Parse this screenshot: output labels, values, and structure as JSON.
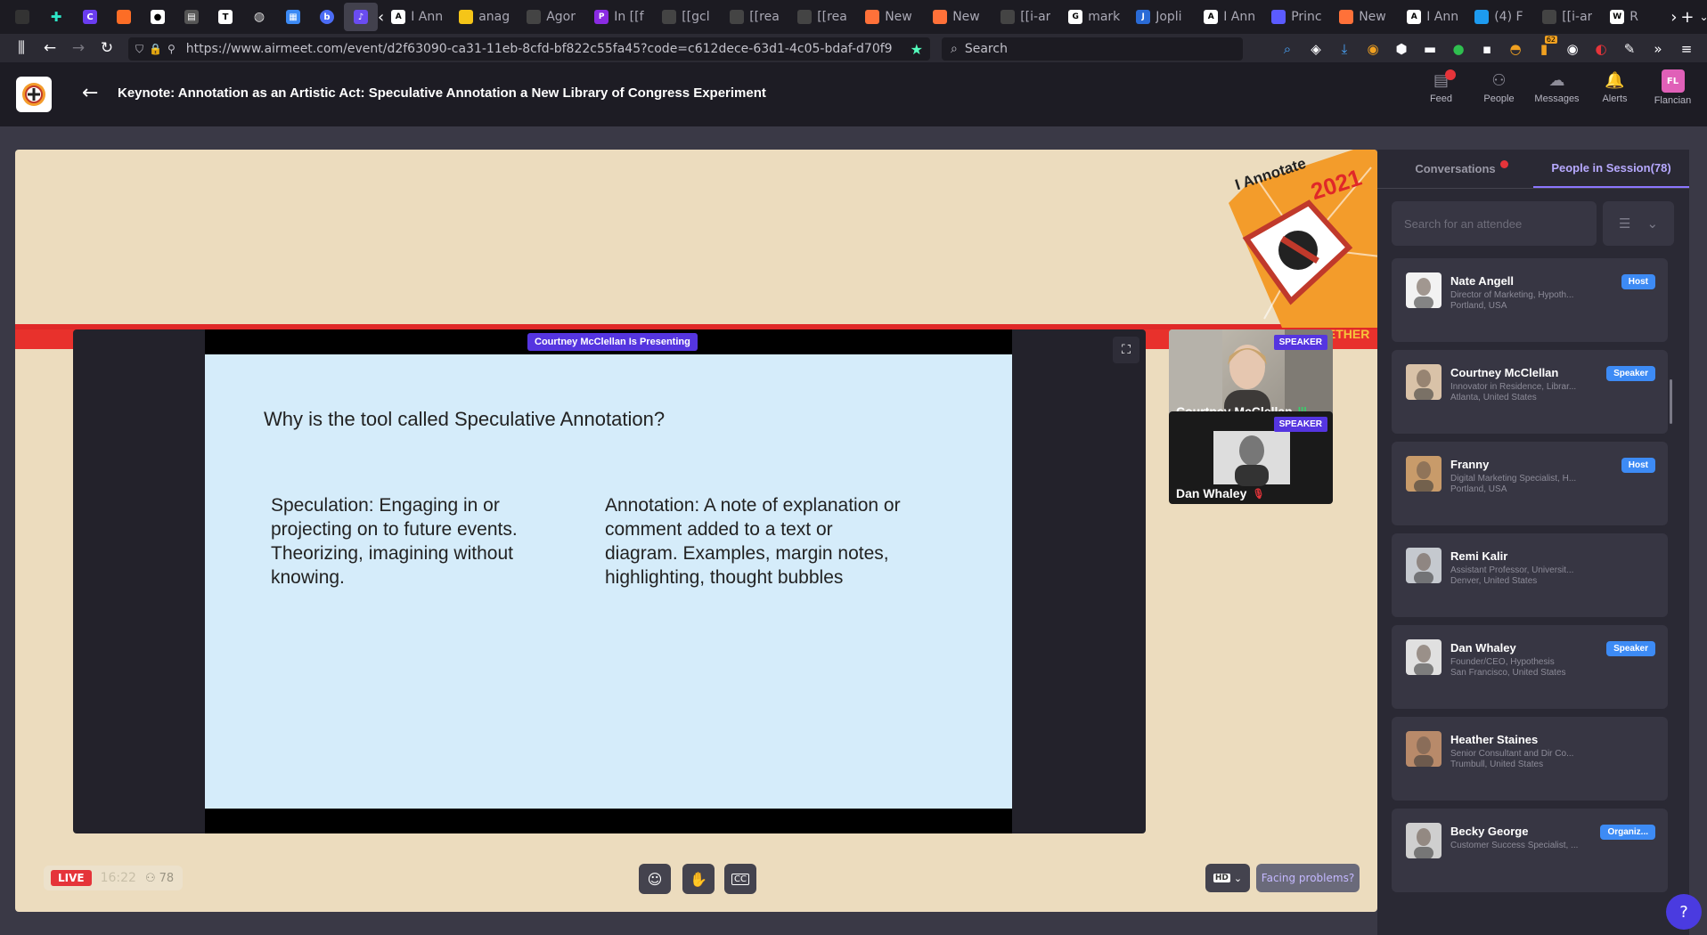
{
  "browser": {
    "tabs": [
      {
        "label": "I Ann",
        "fav": "A",
        "color": "#ffffff"
      },
      {
        "label": "anag",
        "fav": "",
        "color": "#f5c518"
      },
      {
        "label": "Agor",
        "fav": "",
        "color": "#444444"
      },
      {
        "label": "In [[f",
        "fav": "P",
        "color": "#8a2be2"
      },
      {
        "label": "[[gcl",
        "fav": "",
        "color": "#444444"
      },
      {
        "label": "[[rea",
        "fav": "",
        "color": "#444444"
      },
      {
        "label": "[[rea",
        "fav": "",
        "color": "#444444"
      },
      {
        "label": "New",
        "fav": "",
        "color": "#ff7139"
      },
      {
        "label": "New",
        "fav": "",
        "color": "#ff7139"
      },
      {
        "label": "[[i-ar",
        "fav": "",
        "color": "#444444"
      },
      {
        "label": "mark",
        "fav": "G",
        "color": "#ffffff"
      },
      {
        "label": "Jopli",
        "fav": "J",
        "color": "#2a6bd6"
      },
      {
        "label": "I Ann",
        "fav": "A",
        "color": "#ffffff"
      },
      {
        "label": "Princ",
        "fav": "",
        "color": "#5b5bff"
      },
      {
        "label": "New",
        "fav": "",
        "color": "#ff7139"
      },
      {
        "label": "I Ann",
        "fav": "A",
        "color": "#ffffff"
      },
      {
        "label": "(4) F",
        "fav": "",
        "color": "#1d9bf0"
      },
      {
        "label": "[[i-ar",
        "fav": "",
        "color": "#444444"
      },
      {
        "label": "R",
        "fav": "W",
        "color": "#ffffff"
      }
    ],
    "url": "https://www.airmeet.com/event/d2f63090-ca31-11eb-8cfd-bf822c55fa45?code=c612dece-63d1-4c05-bdaf-d70f9",
    "search_placeholder": "Search",
    "ext_badge": "62"
  },
  "header": {
    "title": "Keynote: Annotation as an Artistic Act: Speculative Annotation a New Library of Congress Experiment",
    "nav": [
      {
        "label": "Feed",
        "icon": "feed-icon"
      },
      {
        "label": "People",
        "icon": "people-icon"
      },
      {
        "label": "Messages",
        "icon": "messages-icon"
      },
      {
        "label": "Alerts",
        "icon": "bell-icon"
      },
      {
        "label": "Flancian",
        "icon": "avatar"
      }
    ],
    "avatar_initials": "FL"
  },
  "stage": {
    "badge_top": "I Annotate",
    "badge_year": "2021",
    "together": "GETHER",
    "presenting": "Courtney McClellan Is Presenting",
    "slide": {
      "title": "Why is the tool called Speculative Annotation?",
      "left": "Speculation: Engaging in or projecting on to future events. Theorizing, imagining without knowing.",
      "right": "Annotation: A note of explanation or comment added to a text or diagram. Examples, margin notes, highlighting, thought bubbles"
    },
    "tiles": [
      {
        "name": "Courtney McClellan",
        "badge": "SPEAKER"
      },
      {
        "name": "Dan Whaley",
        "badge": "SPEAKER"
      }
    ],
    "live": "LIVE",
    "time": "16:22",
    "count": "78",
    "hd": "HD",
    "facing": "Facing problems?"
  },
  "sidebar": {
    "tab_conversations": "Conversations",
    "tab_people": "People in Session(78)",
    "search_placeholder": "Search for an attendee",
    "people": [
      {
        "name": "Nate Angell",
        "title": "Director of Marketing, Hypoth...",
        "loc": "Portland, USA",
        "role": "Host"
      },
      {
        "name": "Courtney McClellan",
        "title": "Innovator in Residence, Librar...",
        "loc": "Atlanta, United States",
        "role": "Speaker"
      },
      {
        "name": "Franny",
        "title": "Digital Marketing Specialist, H...",
        "loc": "Portland, USA",
        "role": "Host"
      },
      {
        "name": "Remi Kalir",
        "title": "Assistant Professor, Universit...",
        "loc": "Denver, United States",
        "role": ""
      },
      {
        "name": "Dan Whaley",
        "title": "Founder/CEO, Hypothesis",
        "loc": "San Francisco, United States",
        "role": "Speaker"
      },
      {
        "name": "Heather Staines",
        "title": "Senior Consultant and Dir Co...",
        "loc": "Trumbull, United States",
        "role": ""
      },
      {
        "name": "Becky George",
        "title": "Customer Success Specialist, ...",
        "loc": "",
        "role": "Organiz..."
      }
    ]
  }
}
